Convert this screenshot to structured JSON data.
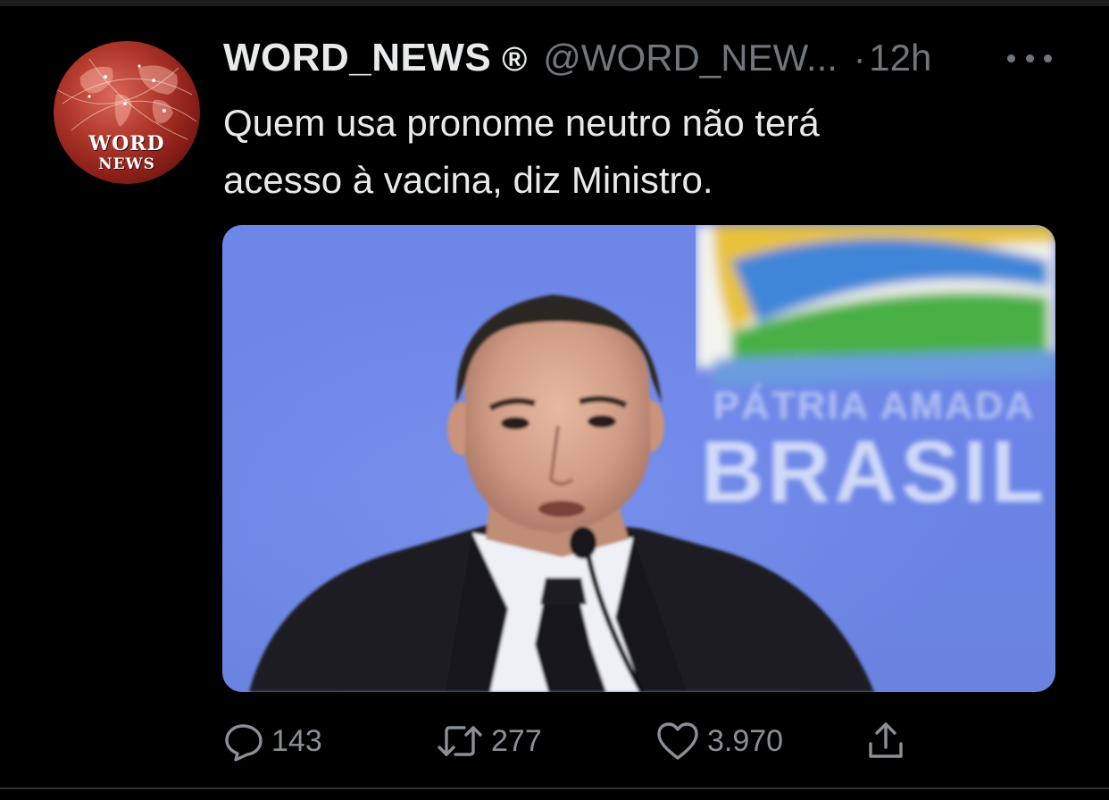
{
  "tweet": {
    "author": {
      "display_name": "WORD_NEWS",
      "registered_mark": "®",
      "handle": "@WORD_NEW...",
      "avatar_logo_line1": "WORD",
      "avatar_logo_line2": "NEWS"
    },
    "separator": "·",
    "time": "12h",
    "text_line1": "Quem usa pronome neutro não terá",
    "text_line2": "acesso à vacina, diz Ministro.",
    "media": {
      "backdrop_text_line1": "PÁTRIA AMADA",
      "backdrop_text_line2": "BRASIL"
    },
    "actions": {
      "reply": {
        "icon": "reply-icon",
        "count": "143"
      },
      "retweet": {
        "icon": "retweet-icon",
        "count": "277"
      },
      "like": {
        "icon": "heart-icon",
        "count": "3.970"
      },
      "share": {
        "icon": "share-icon"
      }
    }
  },
  "colors": {
    "background": "#000000",
    "primary_text": "#e7e9ea",
    "secondary_text": "#71767b",
    "photo_backdrop": "#6e86e8"
  }
}
